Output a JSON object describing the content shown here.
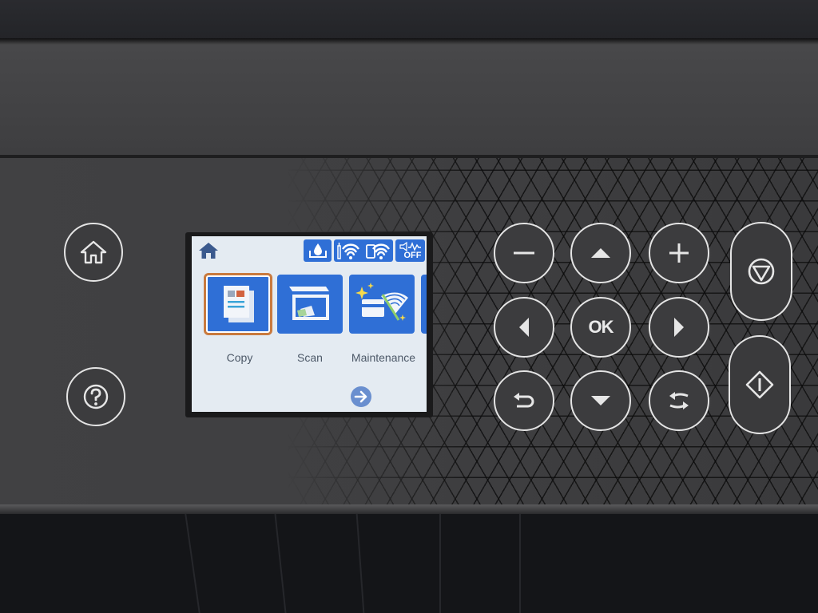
{
  "device": {
    "type": "printer-control-panel"
  },
  "lcd": {
    "status_icons": [
      {
        "name": "ink-level-icon"
      },
      {
        "name": "wifi-direct-icon"
      },
      {
        "name": "wifi-connection-icon"
      },
      {
        "name": "quiet-mode-icon",
        "text": "OFF"
      }
    ],
    "menu_items": [
      {
        "label": "Copy",
        "icon": "copy-icon",
        "selected": true
      },
      {
        "label": "Scan",
        "icon": "scan-icon",
        "selected": false
      },
      {
        "label": "Maintenance",
        "icon": "maintenance-icon",
        "selected": false
      }
    ],
    "next_page_icon": "arrow-right-icon"
  },
  "hard_buttons": {
    "left": [
      {
        "name": "home-button",
        "icon": "home-icon"
      },
      {
        "name": "help-button",
        "icon": "help-icon"
      }
    ],
    "keypad": [
      {
        "name": "minus-button",
        "icon": "minus-icon"
      },
      {
        "name": "up-button",
        "icon": "arrow-up-icon"
      },
      {
        "name": "plus-button",
        "icon": "plus-icon"
      },
      {
        "name": "left-button",
        "icon": "arrow-left-icon"
      },
      {
        "name": "ok-button",
        "label": "OK"
      },
      {
        "name": "right-button",
        "icon": "arrow-right-icon"
      },
      {
        "name": "back-button",
        "icon": "back-icon"
      },
      {
        "name": "down-button",
        "icon": "arrow-down-icon"
      },
      {
        "name": "switch-button",
        "icon": "swap-icon"
      }
    ],
    "right": [
      {
        "name": "stop-button",
        "icon": "stop-icon"
      },
      {
        "name": "start-button",
        "icon": "start-icon"
      }
    ]
  },
  "colors": {
    "lcd_background": "#e4ebf2",
    "tile_blue": "#2f6fd6",
    "selection_orange": "#c97a3e",
    "panel_gray": "#3f3f41",
    "button_outline": "#e4e4e4"
  }
}
